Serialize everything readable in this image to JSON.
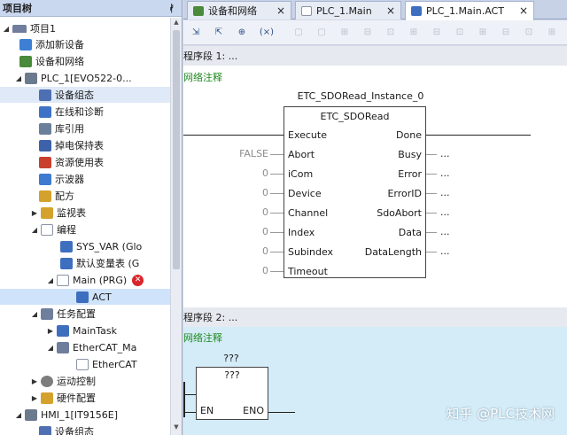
{
  "tree": {
    "title": "项目树",
    "pin_glyph": "ᚯ",
    "items": [
      {
        "label": "项目1",
        "icon": "project-icon",
        "color": "#6f7e9c"
      },
      {
        "label": "添加新设备",
        "icon": "add-device-icon",
        "color": "#3c7fd4"
      },
      {
        "label": "设备和网络",
        "icon": "network-icon",
        "color": "#4a8a3a"
      },
      {
        "label": "PLC_1[EVO522-0...",
        "icon": "plc-icon",
        "color": "#6c7a8e"
      },
      {
        "label": "设备组态",
        "icon": "device-config-icon",
        "color": "#4e6fb1"
      },
      {
        "label": "在线和诊断",
        "icon": "diagnostics-icon",
        "color": "#3d72c6"
      },
      {
        "label": "库引用",
        "icon": "library-icon",
        "color": "#6a7f9a"
      },
      {
        "label": "掉电保持表",
        "icon": "retain-table-icon",
        "color": "#3e62a9"
      },
      {
        "label": "资源使用表",
        "icon": "resource-table-icon",
        "color": "#c8402d"
      },
      {
        "label": "示波器",
        "icon": "oscilloscope-icon",
        "color": "#3d7ad0"
      },
      {
        "label": "配方",
        "icon": "recipe-icon",
        "color": "#d4a22c"
      },
      {
        "label": "监视表",
        "icon": "watch-table-icon",
        "color": "#d4a22c"
      },
      {
        "label": "编程",
        "icon": "programming-icon",
        "color": "#8a94a6"
      },
      {
        "label": "SYS_VAR (Glo",
        "icon": "global-var-icon",
        "color": "#3e6fbf"
      },
      {
        "label": "默认变量表 (G",
        "icon": "var-table-icon",
        "color": "#3e6fbf"
      },
      {
        "label": "Main (PRG)",
        "icon": "program-icon",
        "color": "#8a94a6"
      },
      {
        "label": "ACT",
        "icon": "action-icon",
        "color": "#3e6fbf"
      },
      {
        "label": "任务配置",
        "icon": "task-config-icon",
        "color": "#6f7e9c"
      },
      {
        "label": "MainTask",
        "icon": "task-icon",
        "color": "#3e6fbf"
      },
      {
        "label": "EtherCAT_Ma",
        "icon": "ethercat-task-icon",
        "color": "#6f7e9c"
      },
      {
        "label": "EtherCAT",
        "icon": "ethercat-icon",
        "color": "#8a94a6"
      },
      {
        "label": "运动控制",
        "icon": "motion-icon",
        "color": "#7d7d7d"
      },
      {
        "label": "硬件配置",
        "icon": "hardware-icon",
        "color": "#d4a22c"
      },
      {
        "label": "HMI_1[IT9156E]",
        "icon": "hmi-icon",
        "color": "#6c7a8e"
      },
      {
        "label": "设备组态",
        "icon": "device-config-icon",
        "color": "#4e6fb1"
      }
    ]
  },
  "tabs": [
    {
      "label": "设备和网络",
      "close": "×"
    },
    {
      "label": "PLC_1.Main",
      "close": "×"
    },
    {
      "label": "PLC_1.Main.ACT",
      "close": "×"
    }
  ],
  "toolbar": {
    "glyphs": [
      "⇲",
      "⇱",
      "⊕",
      "(×)",
      "▢",
      "▢",
      "⊞",
      "⊟",
      "⊡",
      "⊞",
      "⊟",
      "⊡",
      "⊞",
      "⊟",
      "⊡",
      "⊞",
      "⊟",
      "⊡",
      "⊞",
      "⊟",
      "⊡"
    ]
  },
  "editor": {
    "network1": {
      "header": "程序段 1:   ...",
      "comment": "网络注释",
      "instance": "ETC_SDORead_Instance_0",
      "block": "ETC_SDORead",
      "inputs": [
        {
          "name": "Execute",
          "value": ""
        },
        {
          "name": "Abort",
          "value": "FALSE"
        },
        {
          "name": "iCom",
          "value": "0"
        },
        {
          "name": "Device",
          "value": "0"
        },
        {
          "name": "Channel",
          "value": "0"
        },
        {
          "name": "Index",
          "value": "0"
        },
        {
          "name": "Subindex",
          "value": "0"
        },
        {
          "name": "Timeout",
          "value": "0"
        }
      ],
      "outputs": [
        {
          "name": "Done",
          "value": ""
        },
        {
          "name": "Busy",
          "value": "..."
        },
        {
          "name": "Error",
          "value": "..."
        },
        {
          "name": "ErrorID",
          "value": "..."
        },
        {
          "name": "SdoAbort",
          "value": "..."
        },
        {
          "name": "Data",
          "value": "..."
        },
        {
          "name": "DataLength",
          "value": "..."
        }
      ]
    },
    "network2": {
      "header": "程序段 2:   ...",
      "comment": "网络注释",
      "instance": "???",
      "block": "???",
      "in_pin": "EN",
      "out_pin": "ENO"
    },
    "colors": {
      "comment": "#1f8a1f",
      "net2_bg": "#d4ecf7",
      "error": "#d8262c"
    }
  },
  "watermark": "知乎 @PLC技术网"
}
